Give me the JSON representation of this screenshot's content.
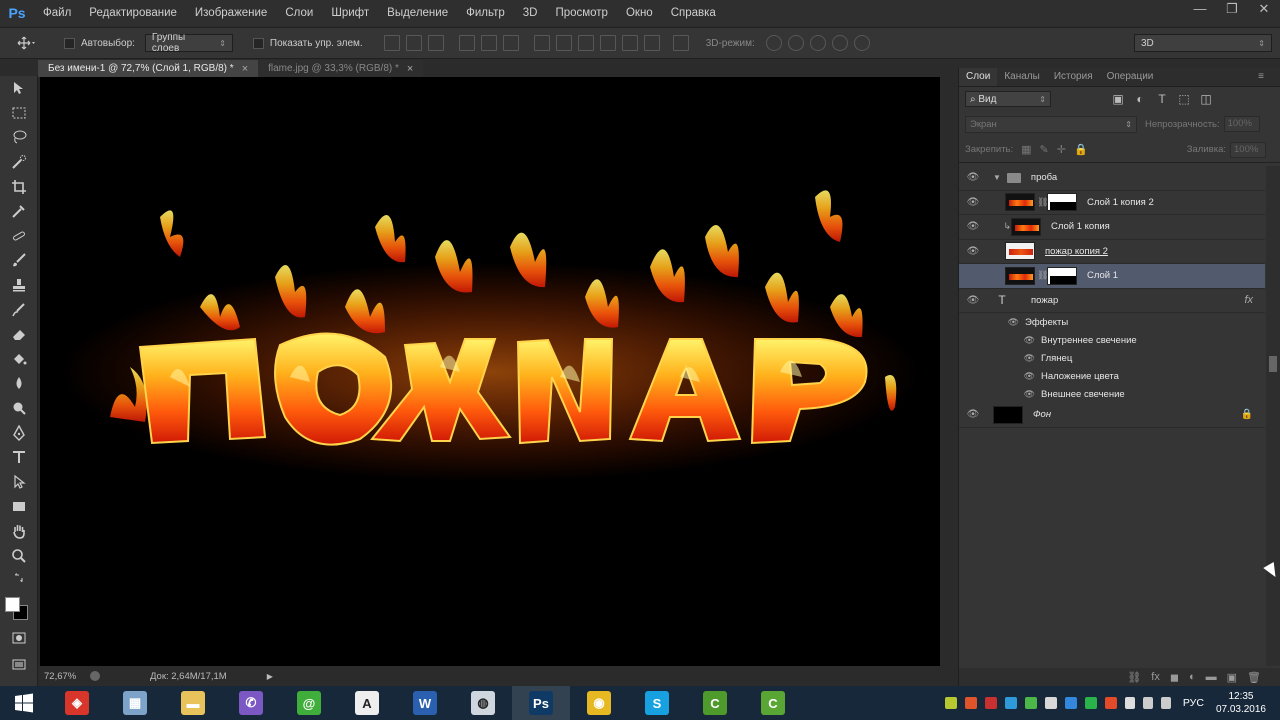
{
  "menu": {
    "logo": "Ps",
    "items": [
      "Файл",
      "Редактирование",
      "Изображение",
      "Слои",
      "Шрифт",
      "Выделение",
      "Фильтр",
      "3D",
      "Просмотр",
      "Окно",
      "Справка"
    ],
    "window_controls": [
      "—",
      "❐",
      "✕"
    ]
  },
  "options": {
    "autoselect_label": "Автовыбор:",
    "autoselect_value": "Группы слоев",
    "show_controls_label": "Показать упр. элем.",
    "mode3d_label": "3D-режим:",
    "workspace_value": "3D"
  },
  "tabs": [
    {
      "label": "Без имени-1 @ 72,7% (Слой 1, RGB/8) *",
      "close": "×"
    },
    {
      "label": "flame.jpg @ 33,3% (RGB/8) *",
      "close": "×"
    }
  ],
  "status": {
    "zoom": "72,67%",
    "doc": "Док: 2,64M/17,1M",
    "arrow": "▶"
  },
  "panel": {
    "tabs": [
      "Слои",
      "Каналы",
      "История",
      "Операции"
    ],
    "filter_value": "Вид",
    "filter_icon": "⌕",
    "blend_mode": "Экран",
    "opacity_label": "Непрозрачность:",
    "opacity_value": "100%",
    "lock_label": "Закрепить:",
    "fill_label": "Заливка:",
    "fill_value": "100%",
    "group_name": "проба",
    "layers": [
      {
        "name": "Слой 1 копия 2"
      },
      {
        "name": "Слой 1 копия"
      },
      {
        "name": "пожар копия 2"
      },
      {
        "name": "Слой 1"
      },
      {
        "name": "пожар"
      },
      {
        "name": "Фон"
      }
    ],
    "effects_label": "Эффекты",
    "effects": [
      "Внутреннее свечение",
      "Глянец",
      "Наложение цвета",
      "Внешнее свечение"
    ],
    "text_icon": "T",
    "fx_label": "fx",
    "footer_icons": [
      "⛓",
      "fx",
      "◼",
      "◐",
      "▬",
      "▣",
      "🗑"
    ]
  },
  "artwork": {
    "text": "ПОЖАР",
    "colors": {
      "hot": "#fff36a",
      "mid": "#ff7a12",
      "deep": "#d11a06"
    }
  },
  "taskbar": {
    "apps": [
      {
        "name": "FineReader",
        "letter": "◈",
        "color": "#d9362b"
      },
      {
        "name": "Calculator",
        "letter": "▦",
        "color": "#7da3c8"
      },
      {
        "name": "Explorer",
        "letter": "▬",
        "color": "#e8c25a"
      },
      {
        "name": "Viber",
        "letter": "✆",
        "color": "#7b58c4"
      },
      {
        "name": "Mail",
        "letter": "@",
        "color": "#3fae3a"
      },
      {
        "name": "Fonts",
        "letter": "A",
        "color": "#eeeeee"
      },
      {
        "name": "Word",
        "letter": "W",
        "color": "#2b5fb0"
      },
      {
        "name": "Dreamweaver",
        "letter": "◍",
        "color": "#cfd6dd"
      },
      {
        "name": "Photoshop",
        "letter": "Ps",
        "color": "#0f3a66"
      },
      {
        "name": "Chrome",
        "letter": "◉",
        "color": "#e6b822"
      },
      {
        "name": "Skype",
        "letter": "S",
        "color": "#17a1e0"
      },
      {
        "name": "Camtasia",
        "letter": "C",
        "color": "#4e9a2a"
      },
      {
        "name": "Camtasia Recorder",
        "letter": "C",
        "color": "#5aa634"
      }
    ],
    "language": "РУС",
    "time": "12:35",
    "date": "07.03.2016"
  }
}
